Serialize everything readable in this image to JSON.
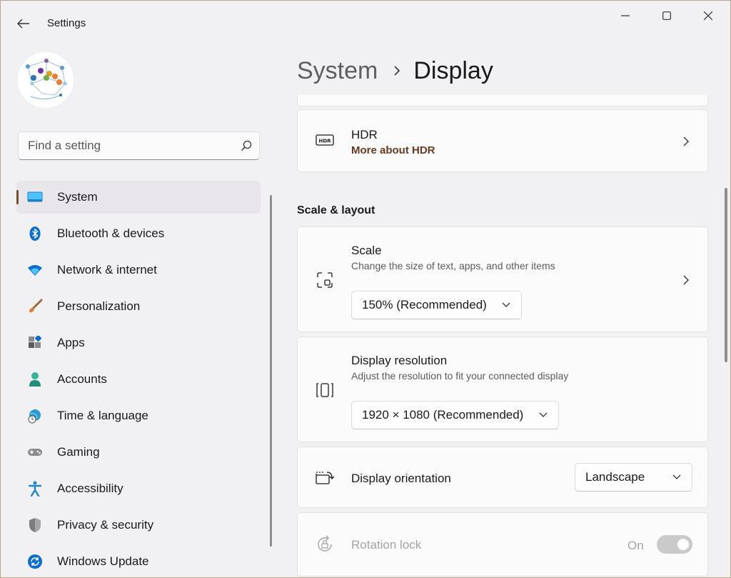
{
  "titlebar": {
    "app_title": "Settings"
  },
  "search": {
    "placeholder": "Find a setting"
  },
  "sidebar": {
    "items": [
      {
        "label": "System",
        "icon": "system-icon",
        "active": true
      },
      {
        "label": "Bluetooth & devices",
        "icon": "bluetooth-icon"
      },
      {
        "label": "Network & internet",
        "icon": "wifi-icon"
      },
      {
        "label": "Personalization",
        "icon": "brush-icon"
      },
      {
        "label": "Apps",
        "icon": "apps-icon"
      },
      {
        "label": "Accounts",
        "icon": "person-icon"
      },
      {
        "label": "Time & language",
        "icon": "globe-clock-icon"
      },
      {
        "label": "Gaming",
        "icon": "gamepad-icon"
      },
      {
        "label": "Accessibility",
        "icon": "accessibility-icon"
      },
      {
        "label": "Privacy & security",
        "icon": "shield-icon"
      },
      {
        "label": "Windows Update",
        "icon": "update-icon"
      }
    ]
  },
  "breadcrumb": {
    "parent": "System",
    "current": "Display"
  },
  "hdr": {
    "title": "HDR",
    "link": "More about HDR"
  },
  "scale_layout": {
    "heading": "Scale & layout",
    "scale": {
      "title": "Scale",
      "subtitle": "Change the size of text, apps, and other items",
      "value": "150% (Recommended)"
    },
    "resolution": {
      "title": "Display resolution",
      "subtitle": "Adjust the resolution to fit your connected display",
      "value": "1920 × 1080 (Recommended)"
    },
    "orientation": {
      "title": "Display orientation",
      "value": "Landscape"
    },
    "rotation_lock": {
      "title": "Rotation lock",
      "state": "On",
      "enabled": false
    }
  },
  "colors": {
    "accent": "#7a4a2a",
    "link": "#6b3a1d",
    "background": "#f1f0f2",
    "card": "#fbfbfb"
  }
}
